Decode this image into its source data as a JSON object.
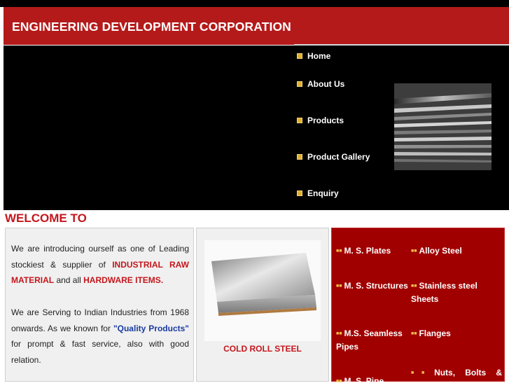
{
  "header": {
    "title": "ENGINEERING DEVELOPMENT CORPORATION"
  },
  "nav": [
    {
      "label": "Home"
    },
    {
      "label": "About Us"
    },
    {
      "label": "Products"
    },
    {
      "label": "Product Gallery"
    },
    {
      "label": "Enquiry"
    }
  ],
  "welcome": {
    "heading": "WELCOME TO"
  },
  "intro": {
    "p1_a": "We are introducing ourself as one of Leading stockiest & supplier of ",
    "p1_hl1": "INDUSTRIAL RAW MATERIAL",
    "p1_b": " and all ",
    "p1_hl2": "HARDWARE ITEMS",
    "p1_c": ".",
    "p2_a": "We are Serving to Indian Industries from 1968 onwards. As we known for ",
    "p2_hl": "\"Quality Products\"",
    "p2_b": " for prompt & fast service, also with good relation."
  },
  "featured": {
    "caption": "COLD ROLL STEEL"
  },
  "products": {
    "left": [
      "M. S. Plates",
      "M. S. Structures",
      "M.S. Seamless Pipes",
      "M. S. Pipe"
    ],
    "right": [
      "Alloy Steel",
      "Stainless steel Sheets",
      "Flanges",
      "Nuts, Bolts &"
    ]
  },
  "colors": {
    "header_red": "#b51a1a",
    "accent_red": "#c4161c",
    "panel_red": "#a10000",
    "nav_bullet": "#e0b030"
  }
}
